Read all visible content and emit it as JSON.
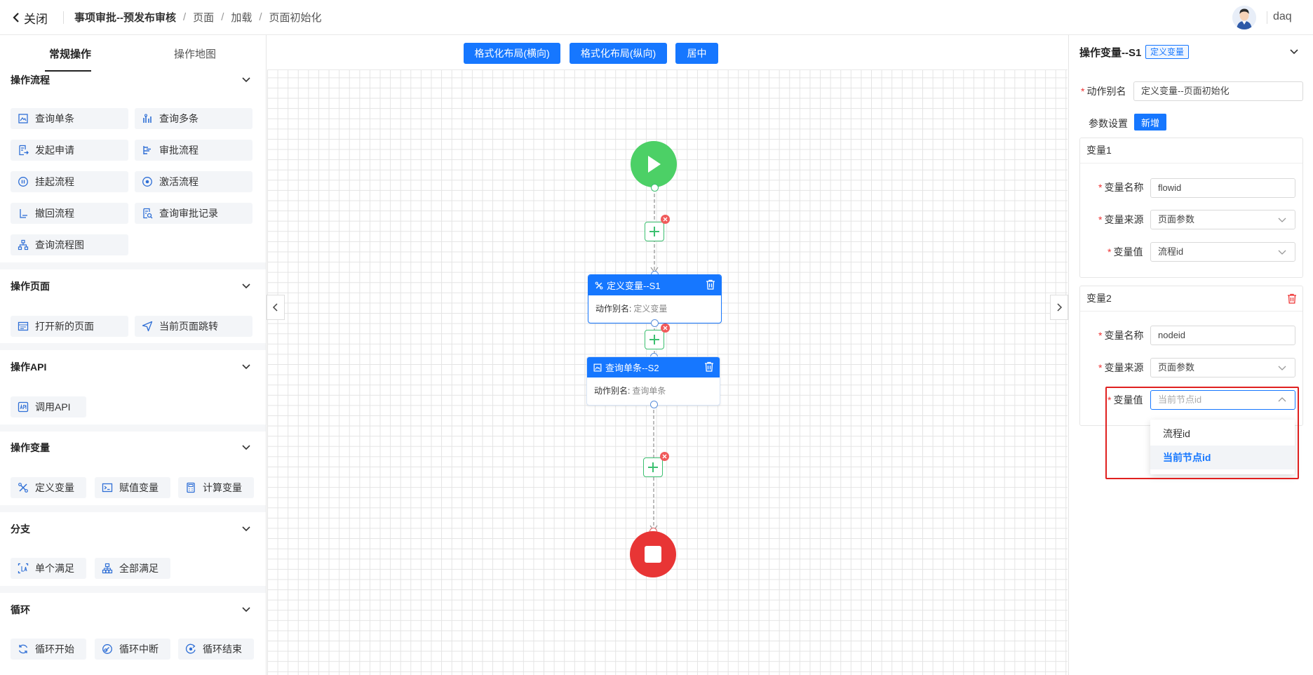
{
  "header": {
    "close_label": "关闭",
    "breadcrumbs": [
      "事项审批--预发布审核",
      "页面",
      "加载",
      "页面初始化"
    ],
    "username": "daq"
  },
  "left_panel": {
    "tabs": [
      "常规操作",
      "操作地图"
    ],
    "sections": [
      {
        "title": "操作流程",
        "items": [
          "查询单条",
          "查询多条",
          "发起申请",
          "审批流程",
          "挂起流程",
          "激活流程",
          "撤回流程",
          "查询审批记录",
          "查询流程图"
        ]
      },
      {
        "title": "操作页面",
        "items": [
          "打开新的页面",
          "当前页面跳转"
        ]
      },
      {
        "title": "操作API",
        "items": [
          "调用API"
        ]
      },
      {
        "title": "操作变量",
        "items": [
          "定义变量",
          "赋值变量",
          "计算变量"
        ]
      },
      {
        "title": "分支",
        "items": [
          "单个满足",
          "全部满足"
        ]
      },
      {
        "title": "循环",
        "items": [
          "循环开始",
          "循环中断",
          "循环结束"
        ]
      }
    ]
  },
  "toolbar": {
    "format_h": "格式化布局(横向)",
    "format_v": "格式化布局(纵向)",
    "center": "居中"
  },
  "flow": {
    "nodes": [
      {
        "title": "定义变量--S1",
        "alias_label": "动作别名:",
        "alias_value": "定义变量"
      },
      {
        "title": "查询单条--S2",
        "alias_label": "动作别名:",
        "alias_value": "查询单条"
      }
    ],
    "colors": {
      "start": "#4cd066",
      "end": "#e83535",
      "node": "#1677ff",
      "connector": "#3cc070"
    }
  },
  "right_panel": {
    "title": "操作变量--S1",
    "tag": "定义变量",
    "alias_label": "动作别名",
    "alias_value": "定义变量--页面初始化",
    "params_label": "参数设置",
    "add_label": "新增",
    "var_name_label": "变量名称",
    "var_source_label": "变量来源",
    "var_value_label": "变量值",
    "vars": [
      {
        "title": "变量1",
        "name": "flowid",
        "source": "页面参数",
        "value": "流程id"
      },
      {
        "title": "变量2",
        "name": "nodeid",
        "source": "页面参数",
        "value_placeholder": "当前节点id"
      }
    ],
    "dropdown_options": [
      "流程id",
      "当前节点id"
    ],
    "dropdown_selected": "当前节点id"
  }
}
